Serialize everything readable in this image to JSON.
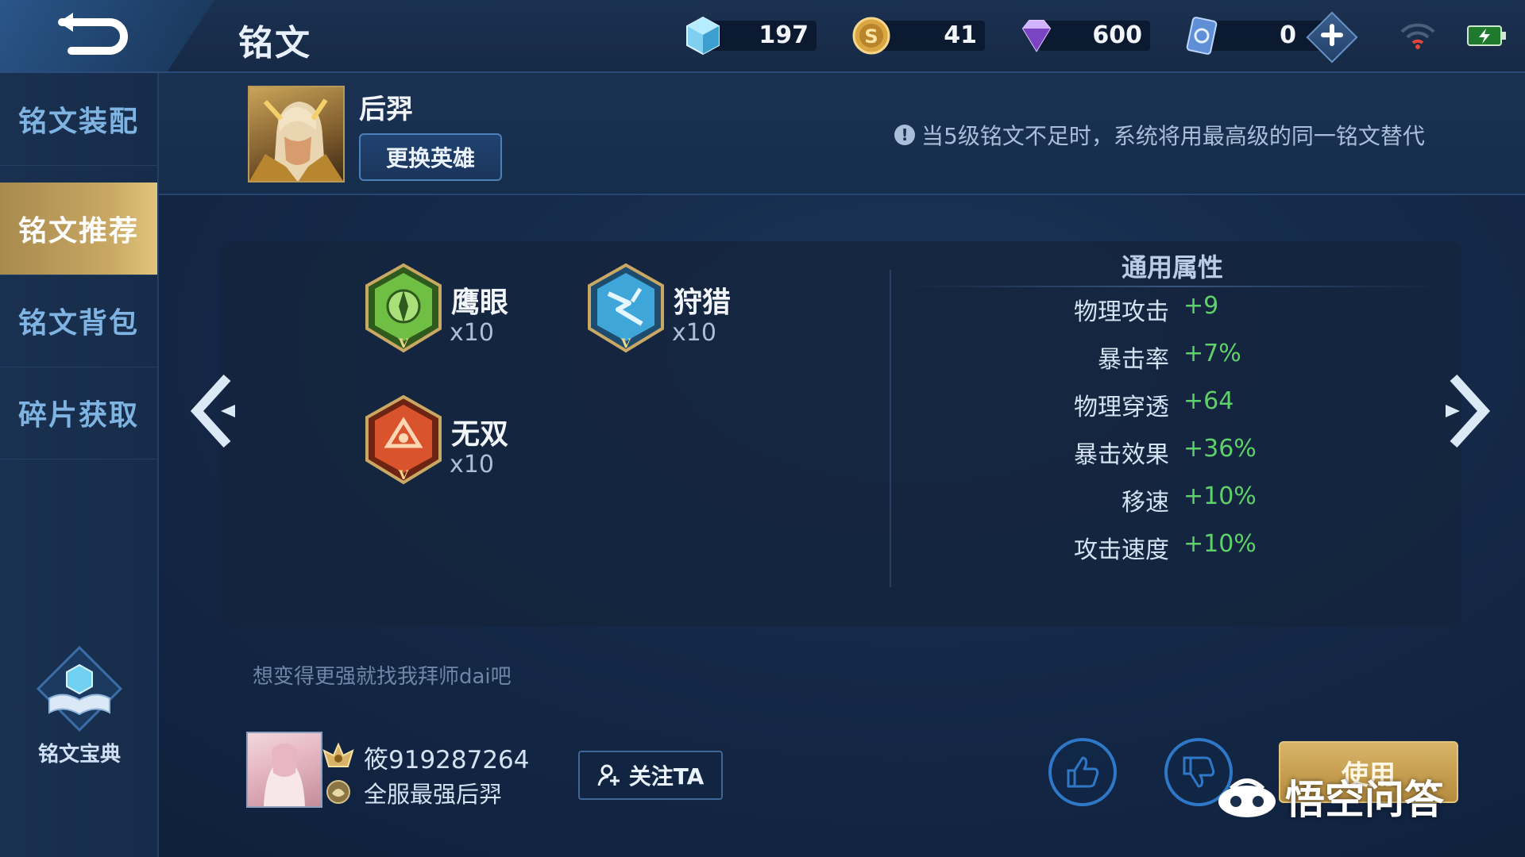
{
  "topbar": {
    "title": "铭文",
    "currencies": [
      {
        "icon": "crystal-icon",
        "value": "197"
      },
      {
        "icon": "coin-icon",
        "value": "41"
      },
      {
        "icon": "diamond-icon",
        "value": "600"
      },
      {
        "icon": "voucher-icon",
        "value": "0"
      }
    ]
  },
  "sidebar": {
    "items": [
      {
        "label": "铭文装配",
        "active": false
      },
      {
        "label": "铭文推荐",
        "active": true
      },
      {
        "label": "铭文背包",
        "active": false
      },
      {
        "label": "碎片获取",
        "active": false
      }
    ],
    "codex_label": "铭文宝典"
  },
  "hero": {
    "name": "后羿",
    "change_label": "更换英雄",
    "notice": "当5级铭文不足时，系统将用最高级的同一铭文替代"
  },
  "runes": [
    {
      "name": "鹰眼",
      "count": "x10",
      "icon": "eagle-eye-rune-icon",
      "level_mark": "V",
      "color": "#6fbf45"
    },
    {
      "name": "狩猎",
      "count": "x10",
      "icon": "hunt-rune-icon",
      "level_mark": "V",
      "color": "#3fa6d9"
    },
    {
      "name": "无双",
      "count": "x10",
      "icon": "peerless-rune-icon",
      "level_mark": "V",
      "color": "#d9532c"
    }
  ],
  "attributes": {
    "title": "通用属性",
    "rows": [
      {
        "name": "物理攻击",
        "value": "+9"
      },
      {
        "name": "暴击率",
        "value": "+7%"
      },
      {
        "name": "物理穿透",
        "value": "+64"
      },
      {
        "name": "暴击效果",
        "value": "+36%"
      },
      {
        "name": "移速",
        "value": "+10%"
      },
      {
        "name": "攻击速度",
        "value": "+10%"
      }
    ]
  },
  "author": {
    "motto": "想变得更强就找我拜师dai吧",
    "name": "筱919287264",
    "title": "全服最强后羿",
    "follow_label": "关注TA"
  },
  "actions": {
    "use_label": "使用"
  },
  "watermark": {
    "text": "悟空问答"
  },
  "colors": {
    "accent_gold": "#c9a864",
    "value_green": "#5fd16a",
    "button_blue": "#2f78c8"
  }
}
